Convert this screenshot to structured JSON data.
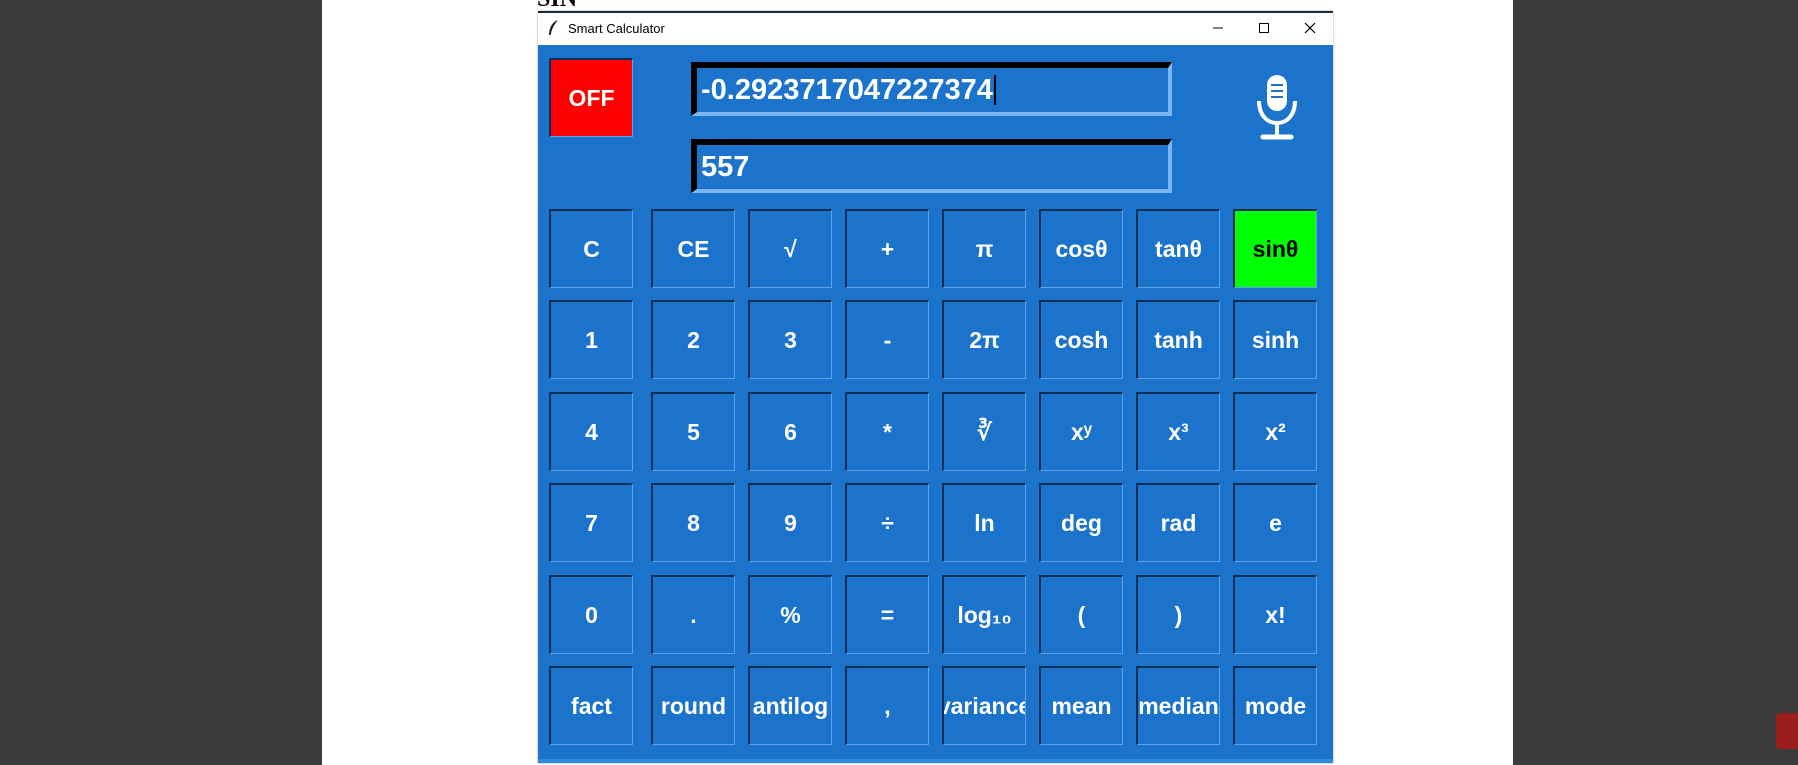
{
  "document": {
    "heading": "SIN"
  },
  "window": {
    "title": "Smart Calculator",
    "controls": {
      "minimize": "minimize-icon",
      "maximize": "maximize-icon",
      "close": "close-icon"
    }
  },
  "calculator": {
    "power_label": "OFF",
    "result_display": "-0.2923717047227374",
    "input_display": "557",
    "mic": "microphone-icon",
    "keys": [
      [
        "C",
        "CE",
        "√",
        "+",
        "π",
        "cosθ",
        "tanθ",
        "sinθ"
      ],
      [
        "1",
        "2",
        "3",
        "-",
        "2π",
        "cosh",
        "tanh",
        "sinh"
      ],
      [
        "4",
        "5",
        "6",
        "*",
        "∛",
        "xʸ",
        "x³",
        "x²"
      ],
      [
        "7",
        "8",
        "9",
        "÷",
        "ln",
        "deg",
        "rad",
        "e"
      ],
      [
        "0",
        ".",
        "%",
        "=",
        "log₁₀",
        "(",
        ")",
        "x!"
      ],
      [
        "fact",
        "round",
        "antilog",
        ",",
        "variance",
        "mean",
        "median",
        "mode"
      ]
    ],
    "colors": {
      "background": "#1b73cc",
      "off_button": "#ff0000",
      "highlight_key": "#00ff00"
    }
  }
}
